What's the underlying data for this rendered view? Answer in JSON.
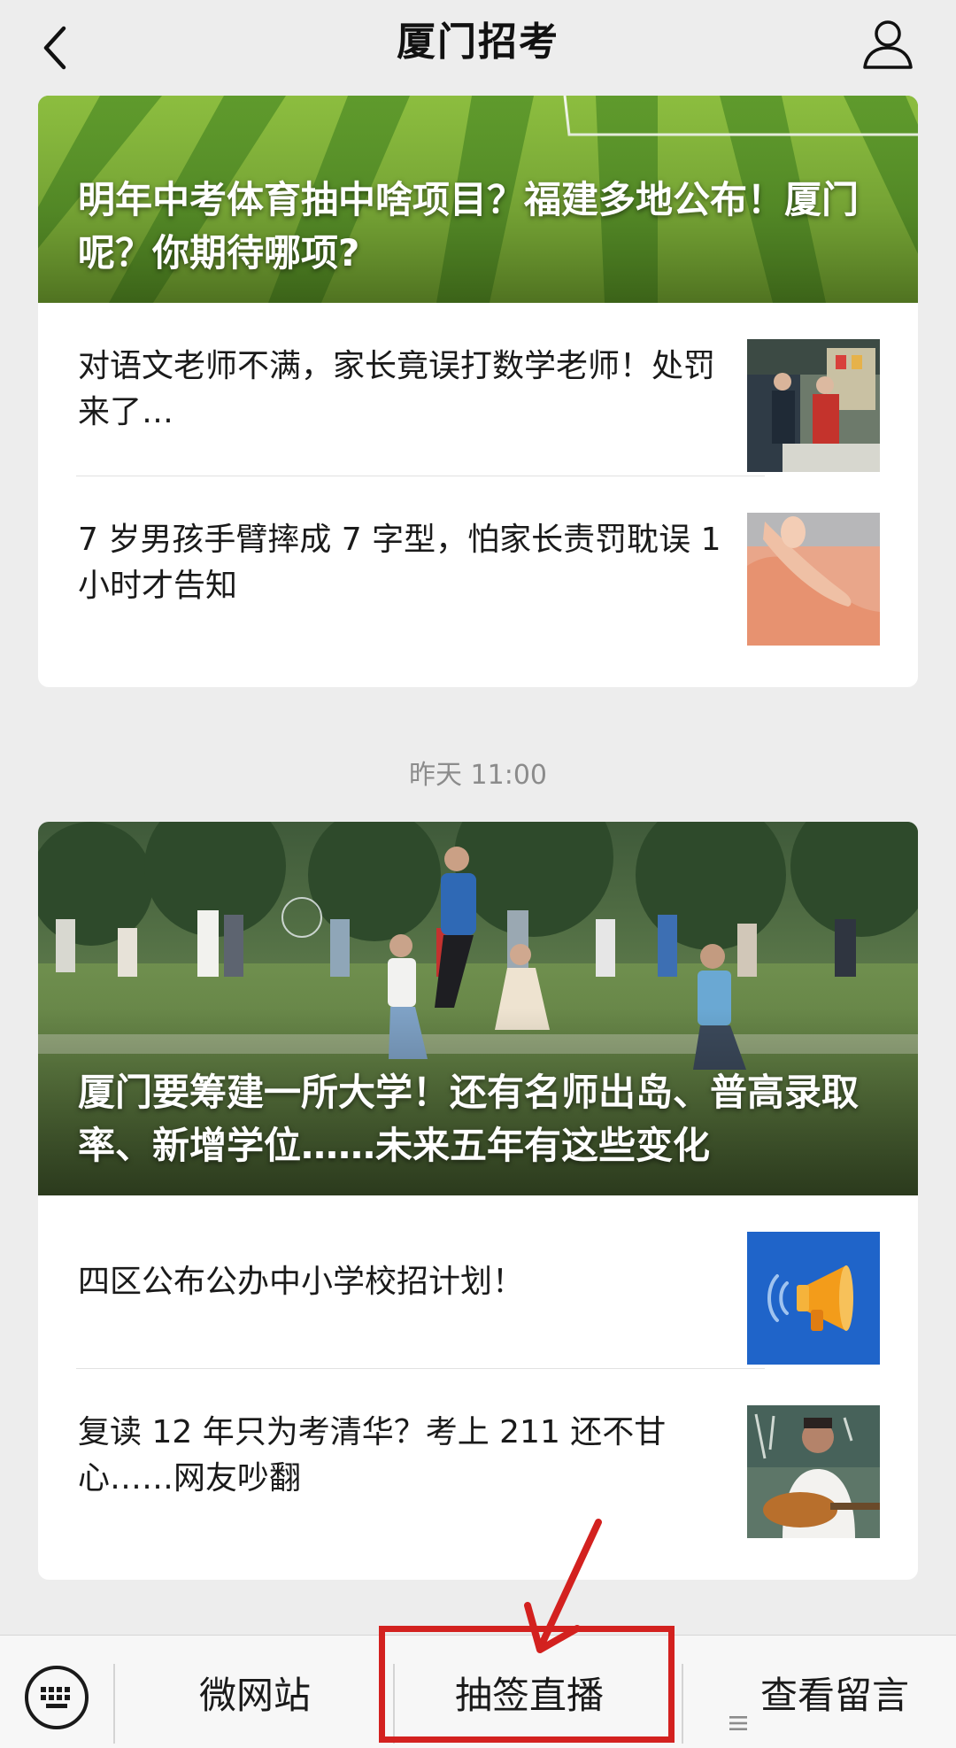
{
  "header": {
    "title": "厦门招考"
  },
  "feed": [
    {
      "hero_title": "明年中考体育抽中啥项目？福建多地公布！厦门呢？你期待哪项?",
      "items": [
        {
          "title": "对语文老师不满，家长竟误打数学老师！处罚来了…"
        },
        {
          "title": "7 岁男孩手臂摔成 7 字型，怕家长责罚耽误 1 小时才告知"
        }
      ]
    },
    {
      "timestamp": "昨天 11:00",
      "hero_title": "厦门要筹建一所大学！还有名师出岛、普高录取率、新增学位……未来五年有这些变化",
      "items": [
        {
          "title": "四区公布公办中小学校招计划！"
        },
        {
          "title": "复读 12 年只为考清华？考上 211 还不甘心……网友吵翻"
        }
      ]
    }
  ],
  "bottom_menu": {
    "items": [
      {
        "label": "微网站"
      },
      {
        "label": "抽签直播"
      },
      {
        "label": "查看留言"
      }
    ]
  },
  "annotation": {
    "color": "#d3211f"
  }
}
